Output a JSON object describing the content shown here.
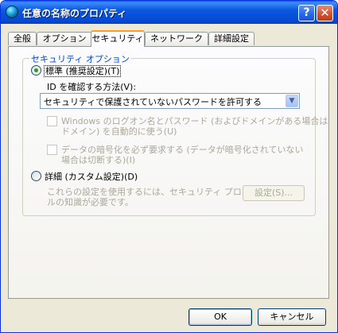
{
  "window": {
    "title": "任意の名称のプロパティ",
    "help_glyph": "?",
    "close_glyph": "✕"
  },
  "tabs": [
    {
      "label": "全般",
      "active": false
    },
    {
      "label": "オプション",
      "active": false
    },
    {
      "label": "セキュリティ",
      "active": true
    },
    {
      "label": "ネットワーク",
      "active": false
    },
    {
      "label": "詳細設定",
      "active": false
    }
  ],
  "security": {
    "group_label": "セキュリティ オプション",
    "standard_label": "標準 (推奨設定)(T)",
    "standard_selected": true,
    "verify_label": "ID を確認する方法(V):",
    "verify_value": "セキュリティで保護されていないパスワードを許可する",
    "auto_logon_label_line1": "Windows のログオン名とパスワード (およびドメインがある場合は",
    "auto_logon_label_line2": "ドメイン) を自動的に使う(U)",
    "encryption_label_line1": "データの暗号化を必ず要求する (データが暗号化されていない",
    "encryption_label_line2": "場合は切断する)(I)",
    "advanced_label": "詳細 (カスタム設定)(D)",
    "advanced_selected": false,
    "advanced_desc_line1": "これらの設定を使用するには、セキュリティ プロトコ",
    "advanced_desc_line2": "ルの知識が必要です。",
    "settings_button": "設定(S)..."
  },
  "buttons": {
    "ok": "OK",
    "cancel": "キャンセル"
  },
  "colors": {
    "title_bar": "#0549d4",
    "group_label": "#0046d5",
    "radio_dot": "#21a121",
    "disabled_text": "#aca899",
    "active_tab_accent": "#ff9c1f"
  }
}
